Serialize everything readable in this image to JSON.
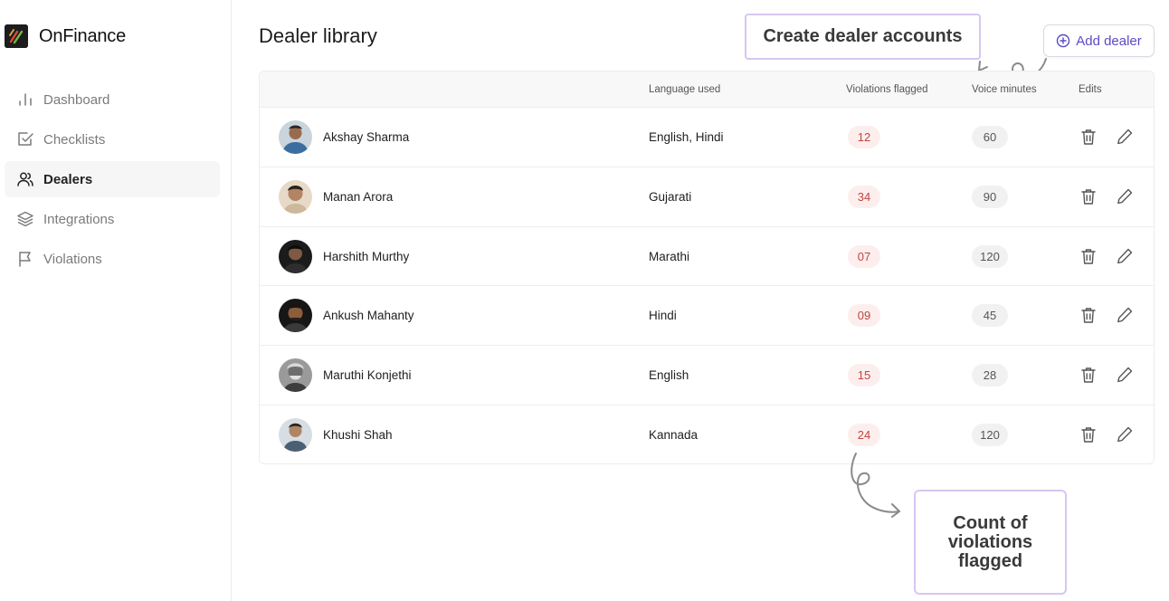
{
  "brand": {
    "name": "OnFinance"
  },
  "sidebar": {
    "items": [
      {
        "label": "Dashboard",
        "icon": "bar-chart-icon",
        "active": false
      },
      {
        "label": "Checklists",
        "icon": "checkbox-icon",
        "active": false
      },
      {
        "label": "Dealers",
        "icon": "users-icon",
        "active": true
      },
      {
        "label": "Integrations",
        "icon": "layers-icon",
        "active": false
      },
      {
        "label": "Violations",
        "icon": "flag-icon",
        "active": false
      }
    ]
  },
  "header": {
    "title": "Dealer library",
    "add_button_label": "Add dealer"
  },
  "annotations": {
    "top": "Create dealer accounts",
    "bottom": "Count of violations flagged"
  },
  "table": {
    "columns": [
      "Language used",
      "Violations flagged",
      "Voice minutes",
      "Edits"
    ],
    "rows": [
      {
        "name": "Akshay Sharma",
        "language": "English, Hindi",
        "violations": "12",
        "minutes": "60"
      },
      {
        "name": "Manan Arora",
        "language": "Gujarati",
        "violations": "34",
        "minutes": "90"
      },
      {
        "name": "Harshith Murthy",
        "language": "Marathi",
        "violations": "07",
        "minutes": "120"
      },
      {
        "name": "Ankush Mahanty",
        "language": "Hindi",
        "violations": "09",
        "minutes": "45"
      },
      {
        "name": "Maruthi Konjethi",
        "language": "English",
        "violations": "15",
        "minutes": "28"
      },
      {
        "name": "Khushi Shah",
        "language": "Kannada",
        "violations": "24",
        "minutes": "120"
      }
    ]
  },
  "colors": {
    "accent": "#5b4bc4",
    "callout_border": "#d7c6f2",
    "violation_text": "#c0453f",
    "violation_bg": "#fdeeee"
  }
}
